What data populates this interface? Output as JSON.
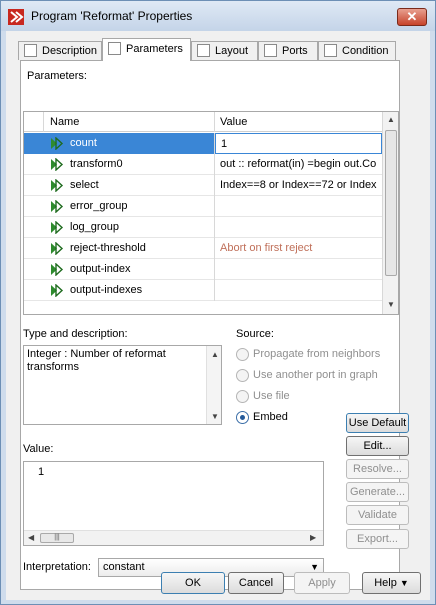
{
  "window": {
    "title": "Program 'Reformat' Properties"
  },
  "tabs": [
    {
      "label": "Description",
      "active": false
    },
    {
      "label": "Parameters",
      "active": true
    },
    {
      "label": "Layout",
      "active": false
    },
    {
      "label": "Ports",
      "active": false
    },
    {
      "label": "Condition",
      "active": false
    }
  ],
  "parameters": {
    "section_label": "Parameters:",
    "columns": [
      "Name",
      "Value"
    ],
    "rows": [
      {
        "name": "count",
        "value": "1"
      },
      {
        "name": "transform0",
        "value": "out :: reformat(in) =begin  out.Co"
      },
      {
        "name": "select",
        "value": "Index==8 or Index==72 or Index"
      },
      {
        "name": "error_group",
        "value": ""
      },
      {
        "name": "log_group",
        "value": ""
      },
      {
        "name": "reject-threshold",
        "value": "Abort on first reject"
      },
      {
        "name": "output-index",
        "value": ""
      },
      {
        "name": "output-indexes",
        "value": ""
      }
    ]
  },
  "description": {
    "label": "Type and description:",
    "text": "Integer : Number of reformat transforms"
  },
  "source": {
    "label": "Source:",
    "options": [
      {
        "label": "Propagate from neighbors",
        "checked": false,
        "enabled": false
      },
      {
        "label": "Use another port in graph",
        "checked": false,
        "enabled": false
      },
      {
        "label": "Use file",
        "checked": false,
        "enabled": false
      },
      {
        "label": "Embed",
        "checked": true,
        "enabled": true
      }
    ]
  },
  "value_editor": {
    "label": "Value:",
    "text": "1"
  },
  "side_buttons": [
    {
      "label": "Use Default",
      "enabled": true
    },
    {
      "label": "Edit...",
      "enabled": true
    },
    {
      "label": "Resolve...",
      "enabled": false
    },
    {
      "label": "Generate...",
      "enabled": false
    },
    {
      "label": "Validate",
      "enabled": false
    },
    {
      "label": "Export...",
      "enabled": false
    }
  ],
  "interpretation": {
    "label": "Interpretation:",
    "selected": "constant"
  },
  "footer": {
    "ok": "OK",
    "cancel": "Cancel",
    "apply": "Apply",
    "help": "Help"
  },
  "colors": {
    "selection": "#3a86d6",
    "icon_green": "#2e8b2e",
    "muted_value": "#c0705a"
  }
}
